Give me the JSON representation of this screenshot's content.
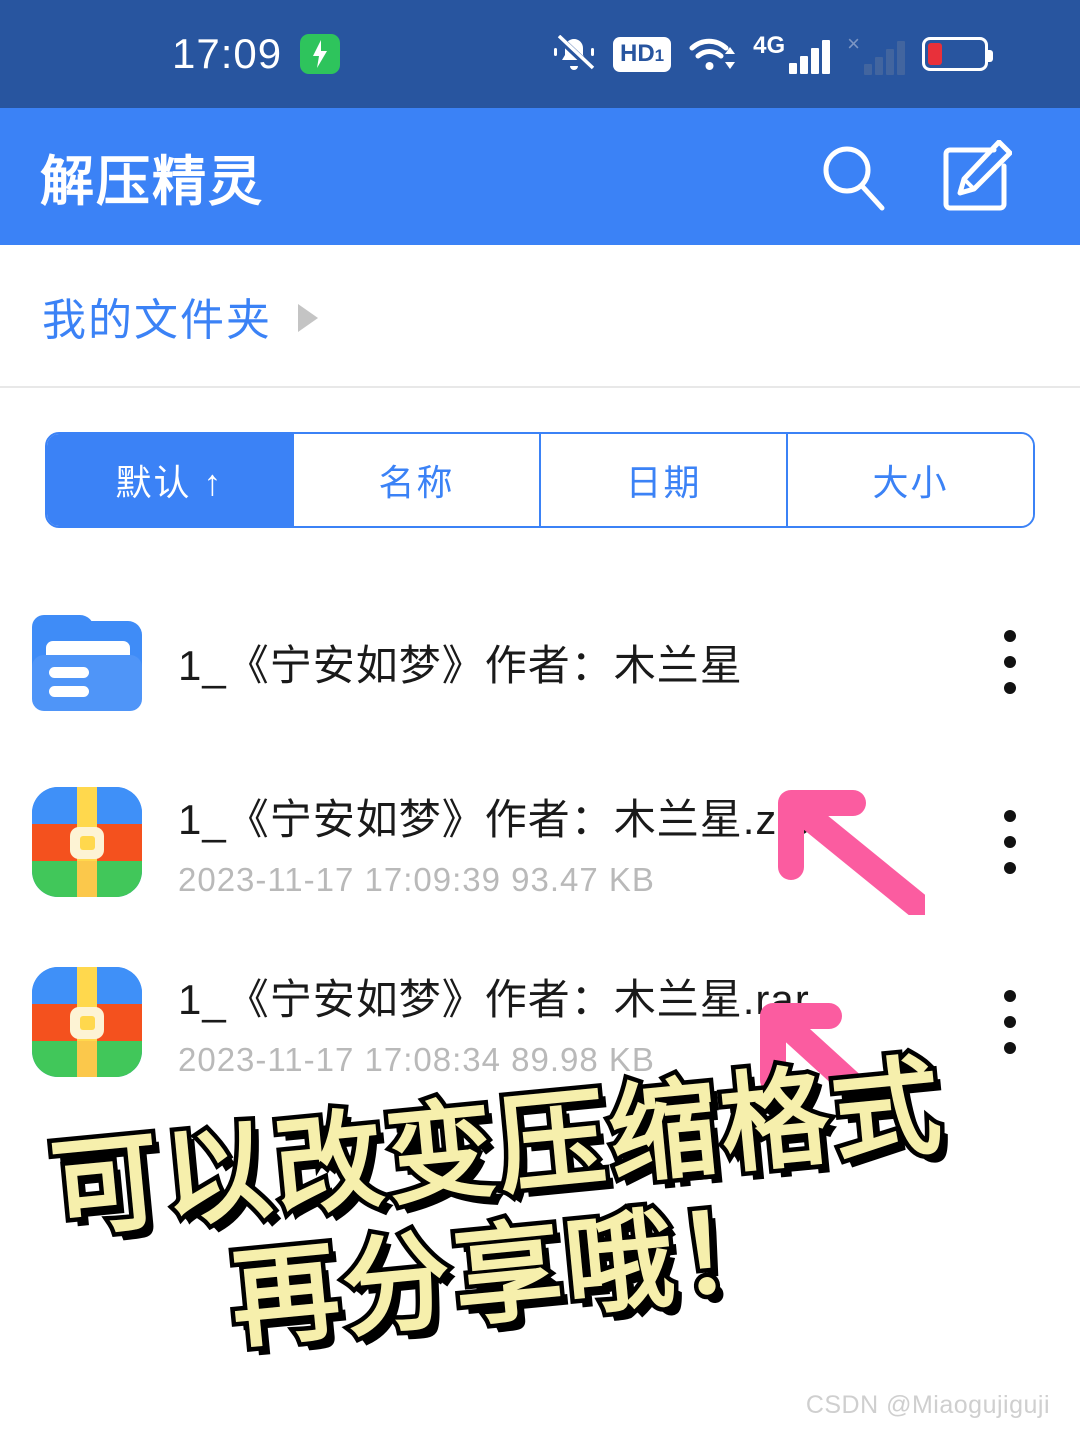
{
  "status_bar": {
    "time": "17:09",
    "charging_icon": "battery-charging-icon",
    "icons": [
      {
        "name": "mute-bell-icon"
      },
      {
        "name": "hd-voice-icon",
        "label": "HD",
        "subscript": "1"
      },
      {
        "name": "wifi-icon"
      },
      {
        "name": "mobile-signal-icon",
        "label": "4G"
      },
      {
        "name": "sim2-no-service-icon",
        "label": "×"
      },
      {
        "name": "battery-icon"
      }
    ],
    "background": "#28559f"
  },
  "app_bar": {
    "title": "解压精灵",
    "background": "#3b82f6",
    "actions": [
      {
        "name": "search-icon",
        "label": "搜索"
      },
      {
        "name": "edit-icon",
        "label": "编辑"
      }
    ]
  },
  "breadcrumb": {
    "label": "我的文件夹",
    "color": "#3b82f6"
  },
  "sort_tabs": {
    "accent": "#3b82f6",
    "items": [
      {
        "label": "默认 ↑",
        "active": true
      },
      {
        "label": "名称",
        "active": false
      },
      {
        "label": "日期",
        "active": false
      },
      {
        "label": "大小",
        "active": false
      }
    ]
  },
  "files": [
    {
      "icon": "folder-icon",
      "name": "1_《宁安如梦》作者：木兰星",
      "meta": "",
      "menu": "more-options-icon"
    },
    {
      "icon": "archive-zip-icon",
      "name": "1_《宁安如梦》作者：木兰星.zip",
      "meta": "2023-11-17 17:09:39   93.47 KB",
      "menu": "more-options-icon"
    },
    {
      "icon": "archive-rar-icon",
      "name": "1_《宁安如梦》作者：木兰星.rar",
      "meta": "2023-11-17 17:08:34   89.98 KB",
      "menu": "more-options-icon"
    }
  ],
  "annotations": {
    "arrow_color": "#fb5ca0",
    "arrows": [
      {
        "name": "pink-arrow-zip"
      },
      {
        "name": "pink-arrow-rar"
      }
    ],
    "caption": {
      "line1": "可以改变压缩格式",
      "line2": "再分享哦！",
      "fill": "#f6efac",
      "outline": "#000000"
    }
  },
  "watermark": {
    "text": "CSDN @Miaogujiguji"
  }
}
